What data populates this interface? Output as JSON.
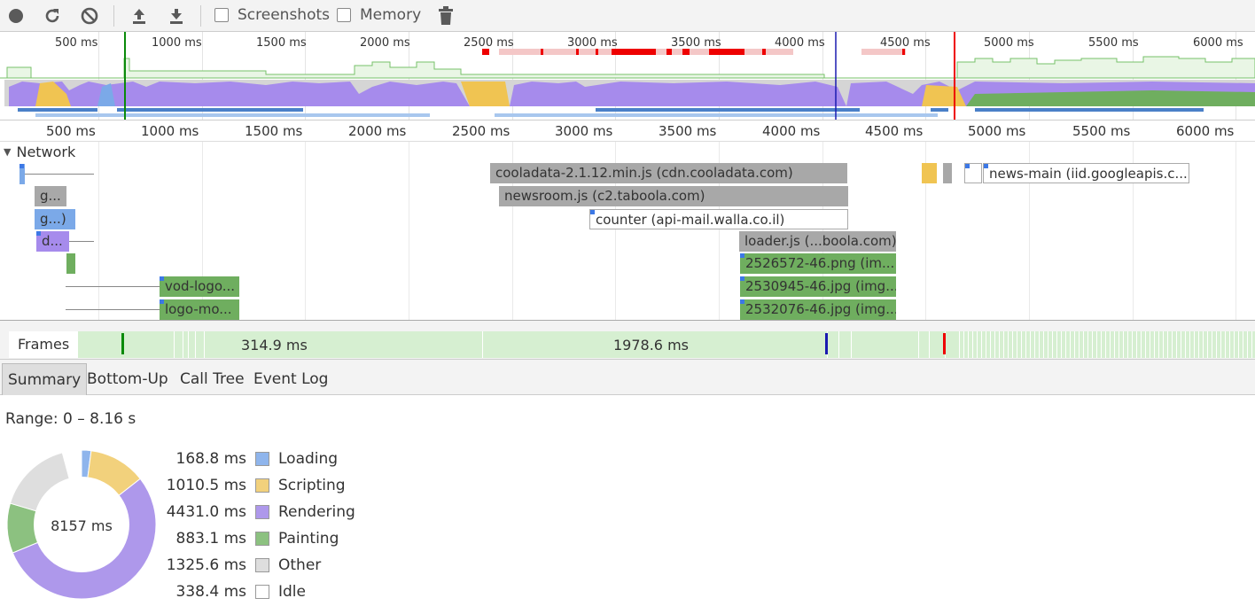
{
  "toolbar": {
    "record_icon": "record-icon",
    "reload_icon": "reload-icon",
    "clear_icon": "clear-icon",
    "upload_icon": "upload-icon",
    "download_icon": "download-icon",
    "screenshots_label": "Screenshots",
    "memory_label": "Memory",
    "trash_icon": "trash-icon"
  },
  "overview": {
    "ticks": [
      "500 ms",
      "1000 ms",
      "1500 ms",
      "2000 ms",
      "2500 ms",
      "3000 ms",
      "3500 ms",
      "4000 ms",
      "4500 ms",
      "5000 ms",
      "5500 ms",
      "6000 ms"
    ]
  },
  "ruler": {
    "ticks": [
      "500 ms",
      "1000 ms",
      "1500 ms",
      "2000 ms",
      "2500 ms",
      "3000 ms",
      "3500 ms",
      "4000 ms",
      "4500 ms",
      "5000 ms",
      "5500 ms",
      "6000 ms"
    ]
  },
  "network": {
    "header": "Network",
    "requests": [
      {
        "label": "cooladata-2.1.12.min.js (cdn.cooladata.com)"
      },
      {
        "label": "newsroom.js (c2.taboola.com)"
      },
      {
        "label": "counter (api-mail.walla.co.il)"
      },
      {
        "label": "loader.js (...boola.com)"
      },
      {
        "label": "2526572-46.png (im..."
      },
      {
        "label": "2530945-46.jpg (img..."
      },
      {
        "label": "2532076-46.jpg (img..."
      },
      {
        "label": "news-main (iid.googleapis.c..."
      },
      {
        "label": "g..."
      },
      {
        "label": "g...)"
      },
      {
        "label": "d..."
      },
      {
        "label": "vod-logo..."
      },
      {
        "label": "logo-mo..."
      }
    ],
    "more": "..."
  },
  "frames": {
    "label": "Frames",
    "values": [
      "314.9 ms",
      "1978.6 ms"
    ]
  },
  "tabs": [
    "Summary",
    "Bottom-Up",
    "Call Tree",
    "Event Log"
  ],
  "summary": {
    "range": "Range: 0 – 8.16 s",
    "total": "8157 ms",
    "categories": [
      {
        "value": "168.8 ms",
        "label": "Loading",
        "color": "#8fb5ec",
        "ms": 168.8
      },
      {
        "value": "1010.5 ms",
        "label": "Scripting",
        "color": "#f2d17c",
        "ms": 1010.5
      },
      {
        "value": "4431.0 ms",
        "label": "Rendering",
        "color": "#ae98eb",
        "ms": 4431.0
      },
      {
        "value": "883.1 ms",
        "label": "Painting",
        "color": "#8cc180",
        "ms": 883.1
      },
      {
        "value": "1325.6 ms",
        "label": "Other",
        "color": "#dedede",
        "ms": 1325.6
      },
      {
        "value": "338.4 ms",
        "label": "Idle",
        "color": "#ffffff",
        "ms": 338.4
      }
    ]
  }
}
